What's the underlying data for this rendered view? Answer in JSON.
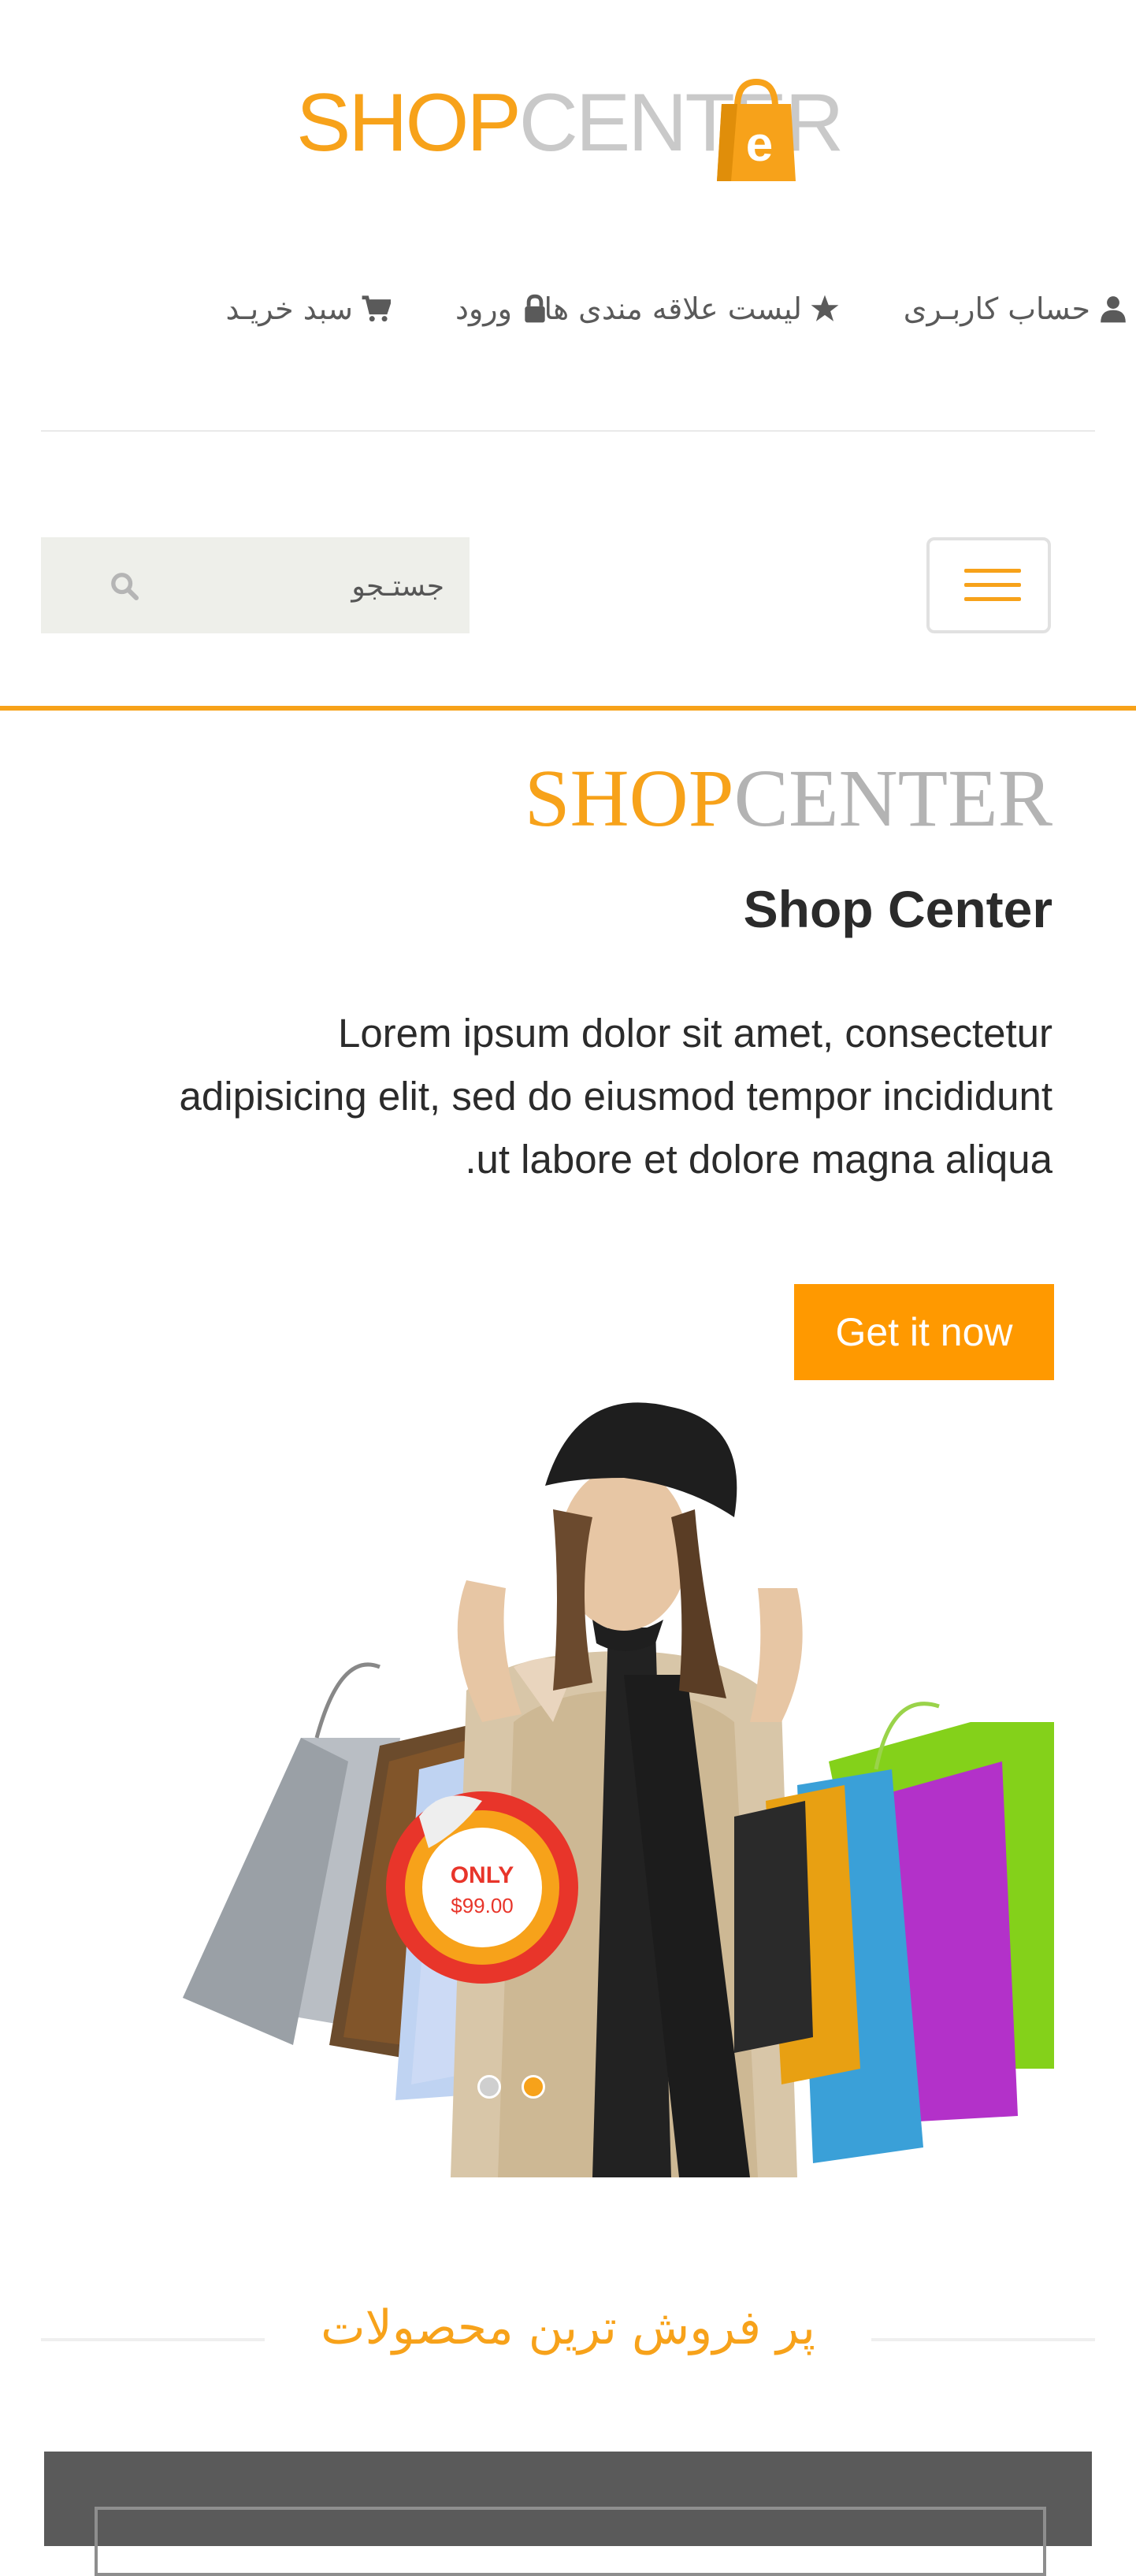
{
  "header": {
    "logo_shop": "SHOP",
    "logo_center": "CENTER",
    "logo_badge": "e",
    "brand_color": "#f7a21a"
  },
  "topnav": {
    "items": [
      {
        "label": "حساب کاربـری",
        "icon": "user-icon"
      },
      {
        "label": "لیست علاقه مندی ها",
        "icon": "star-icon"
      },
      {
        "label": "ورود",
        "icon": "lock-icon"
      },
      {
        "label": "سبد خریـد",
        "icon": "cart-icon"
      }
    ]
  },
  "search": {
    "placeholder": "جستـجو",
    "icon": "search-icon"
  },
  "menu": {
    "icon": "hamburger-menu-icon"
  },
  "hero": {
    "brand_part1": "SHOP",
    "brand_part2": "CENTER",
    "subtitle": "Shop Center",
    "text_line1": "Lorem ipsum dolor sit amet, consectetur",
    "text_line2": "adipisicing elit, sed do eiusmod tempor incididunt",
    "text_line3": ".ut labore et dolore magna aliqua",
    "cta_label": "Get it now",
    "badge_line1": "ONLY",
    "badge_line2": "$99.00",
    "slides": 2,
    "active_slide": 2
  },
  "best_sellers": {
    "title": "پر فروش ترین محصولات"
  }
}
